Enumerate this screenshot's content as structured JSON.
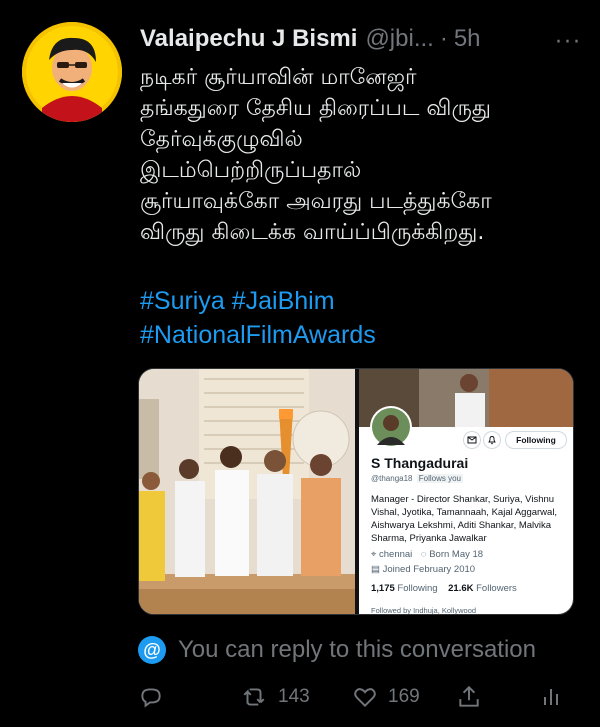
{
  "tweet": {
    "author": {
      "display_name": "Valaipechu J Bismi",
      "handle": "@jbi...",
      "separator": "·",
      "time": "5h"
    },
    "more_label": "···",
    "text_lines": [
      "நடிகர் சூர்யாவின் மானேஜர்",
      "தங்கதுரை தேசிய திரைப்பட விருது",
      "தேர்வுக்குழுவில்",
      "இடம்பெற்றிருப்பதால்",
      "சூர்யாவுக்கோ அவரது படத்துக்கோ",
      "விருது கிடைக்க வாய்ப்பிருக்கிறது."
    ],
    "hashtags": [
      "#Suriya",
      "#JaiBhim",
      "#NationalFilmAwards"
    ],
    "colors": {
      "link": "#1d9bf0",
      "muted": "#71767b",
      "text": "#e7e9ea",
      "background": "#000000"
    }
  },
  "embedded_profile": {
    "name": "S Thangadurai",
    "handle": "@thanga18",
    "follows_you": "Follows you",
    "follow_button": "Following",
    "bio": "Manager - Director Shankar, Suriya, Vishnu Vishal, Jyotika, Tamannaah, Kajal Aggarwal, Aishwarya Lekshmi, Aditi Shankar, Malvika Sharma, Priyanka Jawalkar",
    "location": "chennai",
    "birthday": "Born May 18",
    "joined": "Joined February 2010",
    "following_count": "1,175",
    "following_label": "Following",
    "followers_count": "21.6K",
    "followers_label": "Followers",
    "followed_by": "Followed by Indhuja, Kollywood"
  },
  "reply_notice": {
    "icon": "at-icon",
    "text": "You can reply to this conversation"
  },
  "actions": {
    "reply": {
      "icon": "reply-icon",
      "count": ""
    },
    "retweet": {
      "icon": "retweet-icon",
      "count": "143"
    },
    "like": {
      "icon": "heart-icon",
      "count": "169"
    },
    "share": {
      "icon": "share-icon",
      "count": ""
    },
    "analytics": {
      "icon": "analytics-icon",
      "count": ""
    }
  }
}
